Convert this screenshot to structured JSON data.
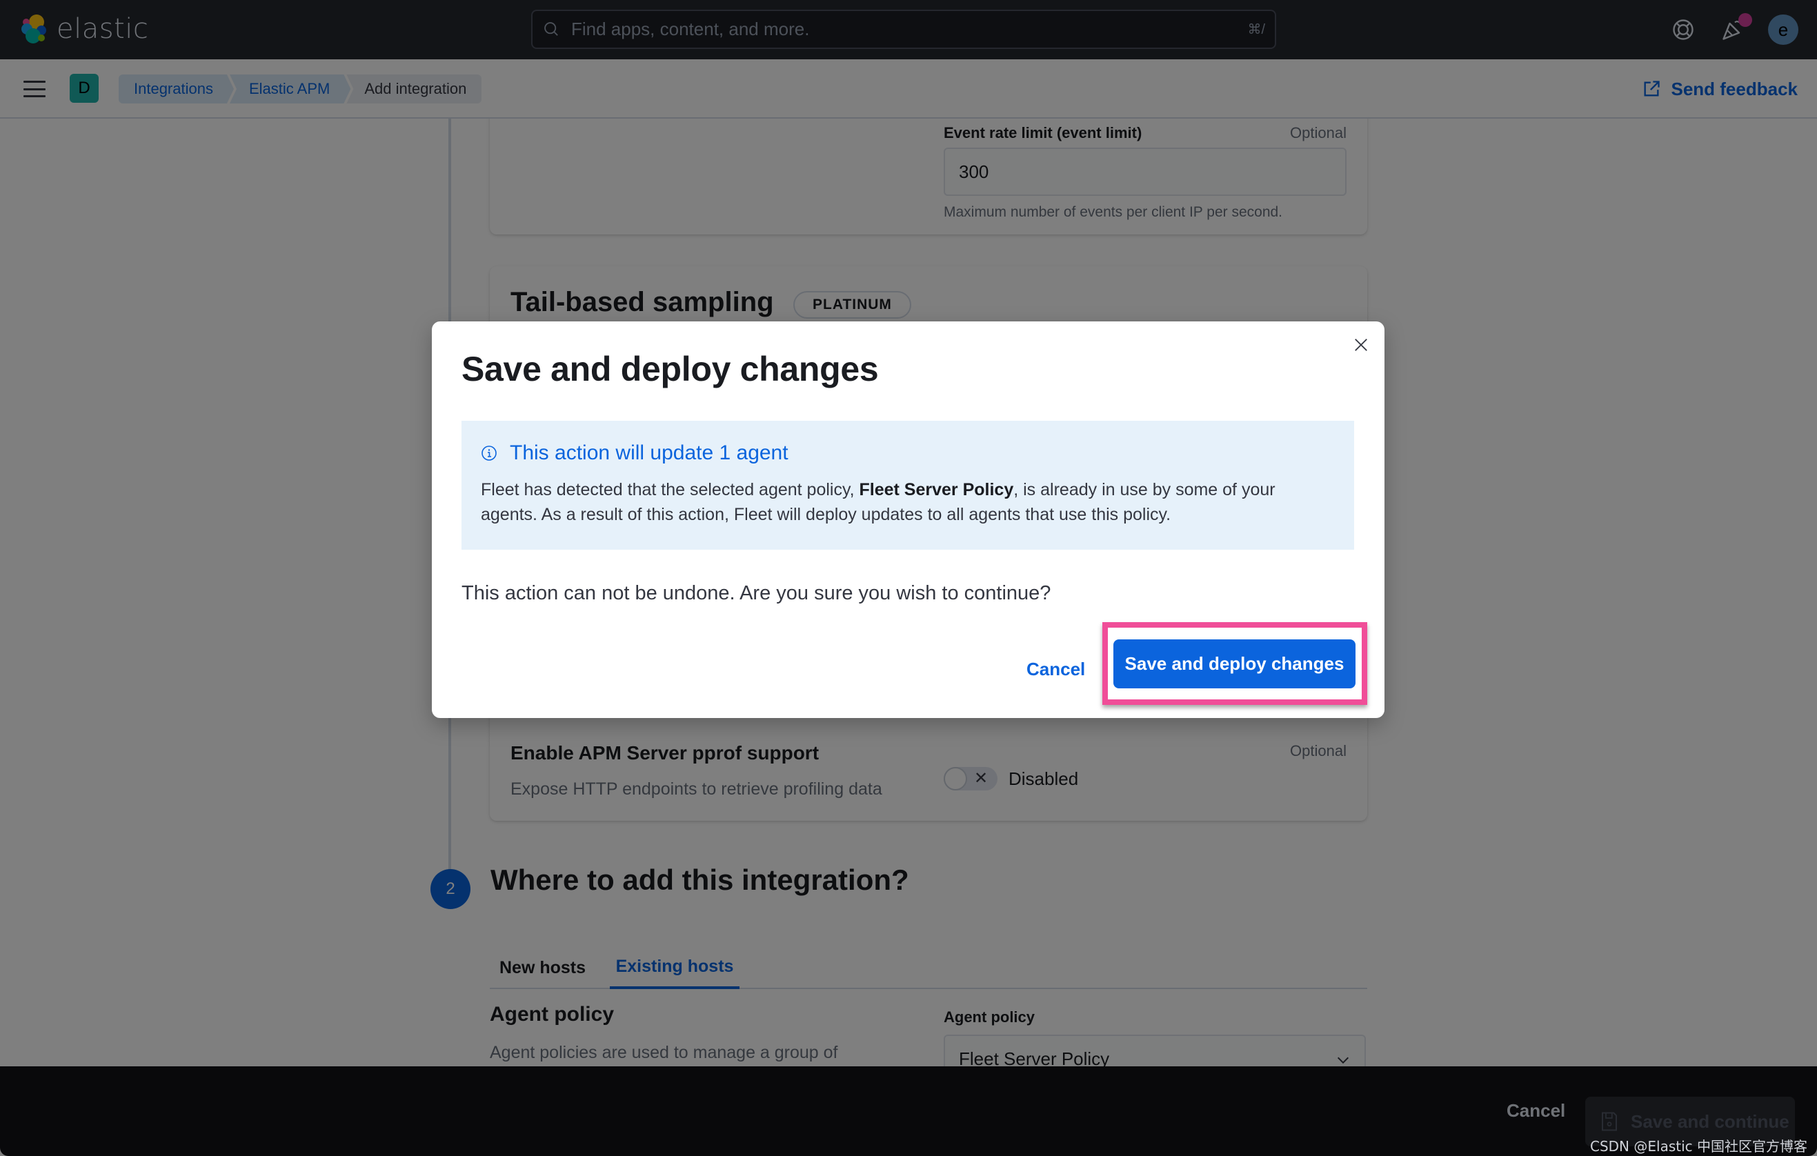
{
  "header": {
    "logo_text": "elastic",
    "search_placeholder": "Find apps, content, and more.",
    "search_shortcut": "⌘/",
    "avatar_initial": "e",
    "icons": [
      "help-icon",
      "newsfeed-icon"
    ]
  },
  "breadcrumb_bar": {
    "space_initial": "D",
    "crumbs": [
      {
        "label": "Integrations"
      },
      {
        "label": "Elastic APM"
      },
      {
        "label": "Add integration"
      }
    ],
    "send_feedback": "Send feedback"
  },
  "background": {
    "event_rate": {
      "label": "Event rate limit (event limit)",
      "optional": "Optional",
      "value": "300",
      "help": "Maximum number of events per client IP per second."
    },
    "tail_sampling": {
      "title": "Tail-based sampling",
      "badge": "PLATINUM"
    },
    "pprof": {
      "title": "Enable APM Server pprof support",
      "description": "Expose HTTP endpoints to retrieve profiling data",
      "optional": "Optional",
      "state_label": "Disabled",
      "enabled": false
    },
    "step2": {
      "number": "2",
      "title": "Where to add this integration?",
      "tabs": [
        {
          "label": "New hosts",
          "active": false
        },
        {
          "label": "Existing hosts",
          "active": true
        }
      ],
      "agent_policy_title": "Agent policy",
      "agent_policy_desc": "Agent policies are used to manage a group of",
      "select_label": "Agent policy",
      "select_value": "Fleet Server Policy"
    }
  },
  "bottom_bar": {
    "cancel": "Cancel",
    "save": "Save and continue"
  },
  "modal": {
    "title": "Save and deploy changes",
    "callout": {
      "title": "This action will update 1 agent",
      "body_pre": "Fleet has detected that the selected agent policy, ",
      "body_bold": "Fleet Server Policy",
      "body_post": ", is already in use by some of your agents. As a result of this action, Fleet will deploy updates to all agents that use this policy."
    },
    "question": "This action can not be undone. Are you sure you wish to continue?",
    "cancel": "Cancel",
    "confirm": "Save and deploy changes"
  },
  "colors": {
    "primary": "#0b64dd",
    "highlight": "#f04e98",
    "callout_bg": "#e6f1fa"
  },
  "watermark": "CSDN @Elastic 中国社区官方博客"
}
